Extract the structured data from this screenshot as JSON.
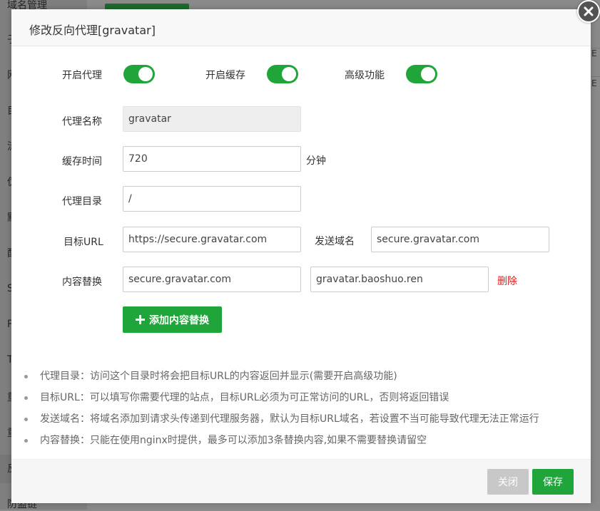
{
  "background": {
    "sidebar_items": [
      "域名管理",
      "子",
      "网",
      "目",
      "流",
      "伪",
      "默",
      "配",
      "S",
      "P",
      "T",
      "重",
      "重",
      "反",
      "防盗链"
    ],
    "right_texts": [
      "E",
      "E"
    ]
  },
  "modal": {
    "title": "修改反向代理[gravatar]",
    "toggles": [
      {
        "label": "开启代理",
        "on": true
      },
      {
        "label": "开启缓存",
        "on": true
      },
      {
        "label": "高级功能",
        "on": true
      }
    ],
    "form": {
      "proxy_name_label": "代理名称",
      "proxy_name_value": "gravatar",
      "cache_time_label": "缓存时间",
      "cache_time_value": "720",
      "cache_time_unit": "分钟",
      "proxy_dir_label": "代理目录",
      "proxy_dir_value": "/",
      "target_url_label": "目标URL",
      "target_url_value": "https://secure.gravatar.com",
      "send_domain_label": "发送域名",
      "send_domain_value": "secure.gravatar.com",
      "content_replace_label": "内容替换",
      "content_replace_from": "secure.gravatar.com",
      "content_replace_to": "gravatar.baoshuo.ren",
      "delete_label": "删除",
      "add_replace_label": "添加内容替换"
    },
    "tips": [
      "代理目录：访问这个目录时将会把目标URL的内容返回并显示(需要开启高级功能)",
      "目标URL：可以填写你需要代理的站点，目标URL必须为可正常访问的URL，否则将返回错误",
      "发送域名：将域名添加到请求头传递到代理服务器，默认为目标URL域名，若设置不当可能导致代理无法正常运行",
      "内容替换：只能在使用nginx时提供，最多可以添加3条替换内容,如果不需要替换请留空"
    ],
    "footer": {
      "close_label": "关闭",
      "save_label": "保存"
    }
  },
  "colors": {
    "accent": "#20a53a",
    "danger": "#e02020",
    "disabled": "#c8c8c8"
  }
}
